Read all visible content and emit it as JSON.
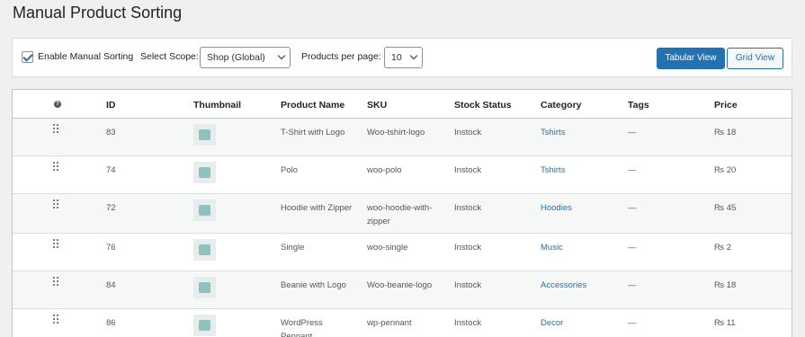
{
  "page": {
    "title": "Manual Product Sorting"
  },
  "toolbar": {
    "enable_label": "Enable Manual Sorting",
    "scope_label": "Select Scope:",
    "scope_value": "Shop (Global)",
    "per_page_label": "Products per page:",
    "per_page_value": "10",
    "tabular_view": "Tabular View",
    "grid_view": "Grid View"
  },
  "table": {
    "headers": {
      "help": "?",
      "id": "ID",
      "thumbnail": "Thumbnail",
      "name": "Product Name",
      "sku": "SKU",
      "stock": "Stock Status",
      "category": "Category",
      "tags": "Tags",
      "price": "Price"
    },
    "rows": [
      {
        "id": "83",
        "name": "T-Shirt with Logo",
        "sku": "Woo-tshirt-logo",
        "stock": "Instock",
        "category": "Tshirts",
        "tags": "—",
        "price": "₨ 18",
        "thumb": "tshirt-thumbnail"
      },
      {
        "id": "74",
        "name": "Polo",
        "sku": "woo-polo",
        "stock": "Instock",
        "category": "Tshirts",
        "tags": "—",
        "price": "₨ 20",
        "thumb": "polo-thumbnail"
      },
      {
        "id": "72",
        "name": "Hoodie with Zipper",
        "sku": "woo-hoodie-with-zipper",
        "stock": "Instock",
        "category": "Hoodies",
        "tags": "—",
        "price": "₨ 45",
        "thumb": "hoodie-thumbnail"
      },
      {
        "id": "76",
        "name": "Single",
        "sku": "woo-single",
        "stock": "Instock",
        "category": "Music",
        "tags": "—",
        "price": "₨ 2",
        "thumb": "single-thumbnail"
      },
      {
        "id": "84",
        "name": "Beanie with Logo",
        "sku": "Woo-beanie-logo",
        "stock": "Instock",
        "category": "Accessories",
        "tags": "—",
        "price": "₨ 18",
        "thumb": "beanie-thumbnail"
      },
      {
        "id": "86",
        "name": "WordPress Pennant",
        "sku": "wp-pennant",
        "stock": "Instock",
        "category": "Decor",
        "tags": "—",
        "price": "₨ 11",
        "thumb": "pennant-thumbnail"
      }
    ]
  }
}
